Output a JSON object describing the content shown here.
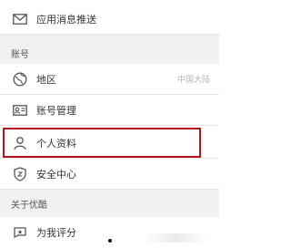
{
  "rows": {
    "push": {
      "label": "应用消息推送",
      "icon": "mail-icon"
    },
    "region": {
      "label": "地区",
      "value": "中国大陆",
      "icon": "globe-icon"
    },
    "account": {
      "label": "账号管理",
      "icon": "id-card-icon"
    },
    "profile": {
      "label": "个人资料",
      "icon": "person-icon"
    },
    "security": {
      "label": "安全中心",
      "icon": "shield-icon"
    },
    "rate": {
      "label": "为我评分",
      "icon": "rating-icon"
    }
  },
  "sections": {
    "account": "账号",
    "about": "关于优酷"
  },
  "colors": {
    "highlight": "#b5121b",
    "section_bg": "#f1f1f1",
    "divider": "#e6e6e6"
  }
}
